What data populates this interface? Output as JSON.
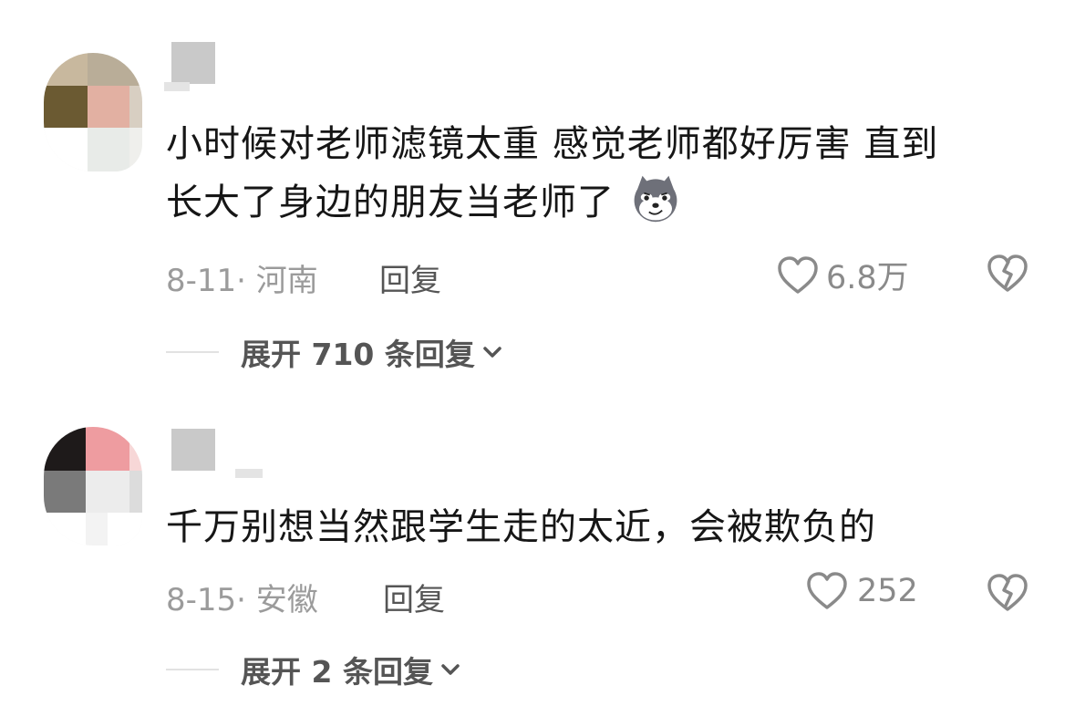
{
  "comments": [
    {
      "text_line1": "小时候对老师滤镜太重 感觉老师都好厉害 直到",
      "text_line2": "长大了身边的朋友当老师了",
      "emoji": "wolf-smirk-emoji",
      "date_location": "8-11· 河南",
      "reply_label": "回复",
      "likes": "6.8万",
      "expand_label": "展开 710 条回复"
    },
    {
      "text_line1": "千万别想当然跟学生走的太近，会被欺负的",
      "date_location": "8-15· 安徽",
      "reply_label": "回复",
      "likes": "252",
      "expand_label": "展开 2 条回复"
    }
  ],
  "colors": {
    "text": "#161616",
    "meta": "#9b9b9b",
    "action": "#555555",
    "icon": "#8a8a8a"
  },
  "icons": [
    "heart-icon",
    "broken-heart-icon",
    "chevron-down-icon"
  ]
}
